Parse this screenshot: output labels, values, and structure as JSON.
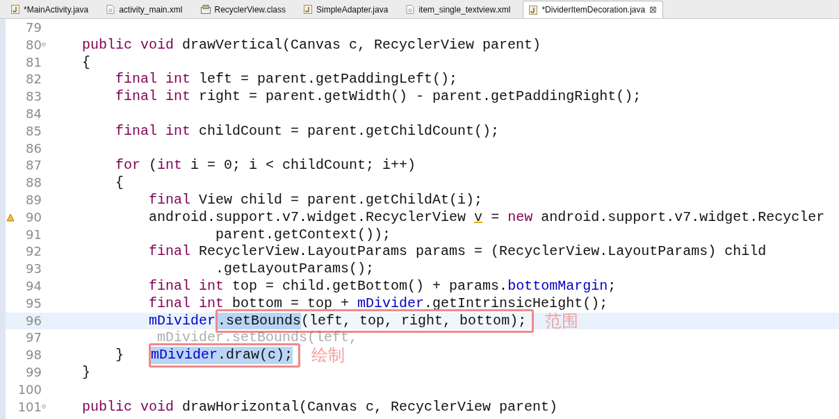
{
  "tabs": [
    {
      "label": "*MainActivity.java",
      "kind": "java",
      "selected": false
    },
    {
      "label": "activity_main.xml",
      "kind": "xml",
      "selected": false
    },
    {
      "label": "RecyclerView.class",
      "kind": "class",
      "selected": false
    },
    {
      "label": "SimpleAdapter.java",
      "kind": "java",
      "selected": false
    },
    {
      "label": "item_single_textview.xml",
      "kind": "xml",
      "selected": false
    },
    {
      "label": "*DividerItemDecoration.java",
      "kind": "java",
      "selected": true,
      "close": "⊠"
    }
  ],
  "lines": [
    {
      "number": "79"
    },
    {
      "number": "80",
      "fold": "⊖",
      "segments": [
        {
          "kind": "keyword",
          "text": "    public void"
        },
        {
          "kind": "plain",
          "text": " drawVertical(Canvas c, RecyclerView parent)"
        }
      ]
    },
    {
      "number": "81",
      "segments": [
        {
          "kind": "plain",
          "text": "    {"
        }
      ]
    },
    {
      "number": "82",
      "segments": [
        {
          "kind": "keyword",
          "text": "        final int"
        },
        {
          "kind": "plain",
          "text": " left = parent.getPaddingLeft();"
        }
      ]
    },
    {
      "number": "83",
      "segments": [
        {
          "kind": "keyword",
          "text": "        final int"
        },
        {
          "kind": "plain",
          "text": " right = parent.getWidth() - parent.getPaddingRight();"
        }
      ]
    },
    {
      "number": "84"
    },
    {
      "number": "85",
      "segments": [
        {
          "kind": "keyword",
          "text": "        final int"
        },
        {
          "kind": "plain",
          "text": " childCount = parent.getChildCount();"
        }
      ]
    },
    {
      "number": "86"
    },
    {
      "number": "87",
      "segments": [
        {
          "kind": "keyword",
          "text": "        for"
        },
        {
          "kind": "plain",
          "text": " ("
        },
        {
          "kind": "keyword",
          "text": "int"
        },
        {
          "kind": "plain",
          "text": " i = 0; i < childCount; i++)"
        }
      ]
    },
    {
      "number": "88",
      "segments": [
        {
          "kind": "plain",
          "text": "        {"
        }
      ]
    },
    {
      "number": "89",
      "segments": [
        {
          "kind": "keyword",
          "text": "            final"
        },
        {
          "kind": "plain",
          "text": " View child = parent.getChildAt(i);"
        }
      ]
    },
    {
      "number": "90",
      "warning": true,
      "segments": [
        {
          "kind": "plain",
          "text": "            android.support.v7.widget.RecyclerView "
        },
        {
          "kind": "warning",
          "text": "v"
        },
        {
          "kind": "plain",
          "text": " = "
        },
        {
          "kind": "keyword",
          "text": "new"
        },
        {
          "kind": "plain",
          "text": " android.support.v7.widget.Recycler"
        }
      ]
    },
    {
      "number": "91",
      "segments": [
        {
          "kind": "plain",
          "text": "                    parent.getContext());"
        }
      ]
    },
    {
      "number": "92",
      "segments": [
        {
          "kind": "keyword",
          "text": "            final"
        },
        {
          "kind": "plain",
          "text": " RecyclerView.LayoutParams params = (RecyclerView.LayoutParams) child"
        }
      ]
    },
    {
      "number": "93",
      "segments": [
        {
          "kind": "plain",
          "text": "                    .getLayoutParams();"
        }
      ]
    },
    {
      "number": "94",
      "segments": [
        {
          "kind": "keyword",
          "text": "            final int"
        },
        {
          "kind": "plain",
          "text": " top = child.getBottom() + params."
        },
        {
          "kind": "field",
          "text": "bottomMargin"
        },
        {
          "kind": "plain",
          "text": ";"
        }
      ]
    },
    {
      "number": "95",
      "segments": [
        {
          "kind": "keyword",
          "text": "            final int"
        },
        {
          "kind": "plain",
          "text": " bottom = top + "
        },
        {
          "kind": "field",
          "text": "mDivider"
        },
        {
          "kind": "plain",
          "text": ".getIntrinsicHeight();"
        }
      ]
    },
    {
      "number": "96",
      "current": true,
      "segments": [
        {
          "kind": "field",
          "text": "            mDivider"
        },
        {
          "kind": "box",
          "note": "范围",
          "segments": [
            {
              "kind": "plain",
              "text": ".setBounds",
              "selected": true
            },
            {
              "kind": "plain",
              "text": "(left, top, right, bottom);",
              "selected": false
            }
          ]
        }
      ]
    },
    {
      "number": "97",
      "segments": [
        {
          "kind": "faded",
          "text": "             mDivider.setBounds(left,"
        }
      ]
    },
    {
      "number": "98",
      "segments": [
        {
          "kind": "plain",
          "text": "        }   "
        },
        {
          "kind": "box",
          "note": "绘制",
          "segments": [
            {
              "kind": "field",
              "text": "mDivider",
              "selected": true
            },
            {
              "kind": "plain",
              "text": ".draw(c);",
              "selected": true
            }
          ]
        }
      ]
    },
    {
      "number": "99",
      "segments": [
        {
          "kind": "plain",
          "text": "    }"
        }
      ]
    },
    {
      "number": "100"
    },
    {
      "number": "101",
      "fold": "⊖",
      "segments": [
        {
          "kind": "keyword",
          "text": "    public void"
        },
        {
          "kind": "plain",
          "text": " drawHorizontal(Canvas c, RecyclerView parent)"
        }
      ]
    }
  ]
}
